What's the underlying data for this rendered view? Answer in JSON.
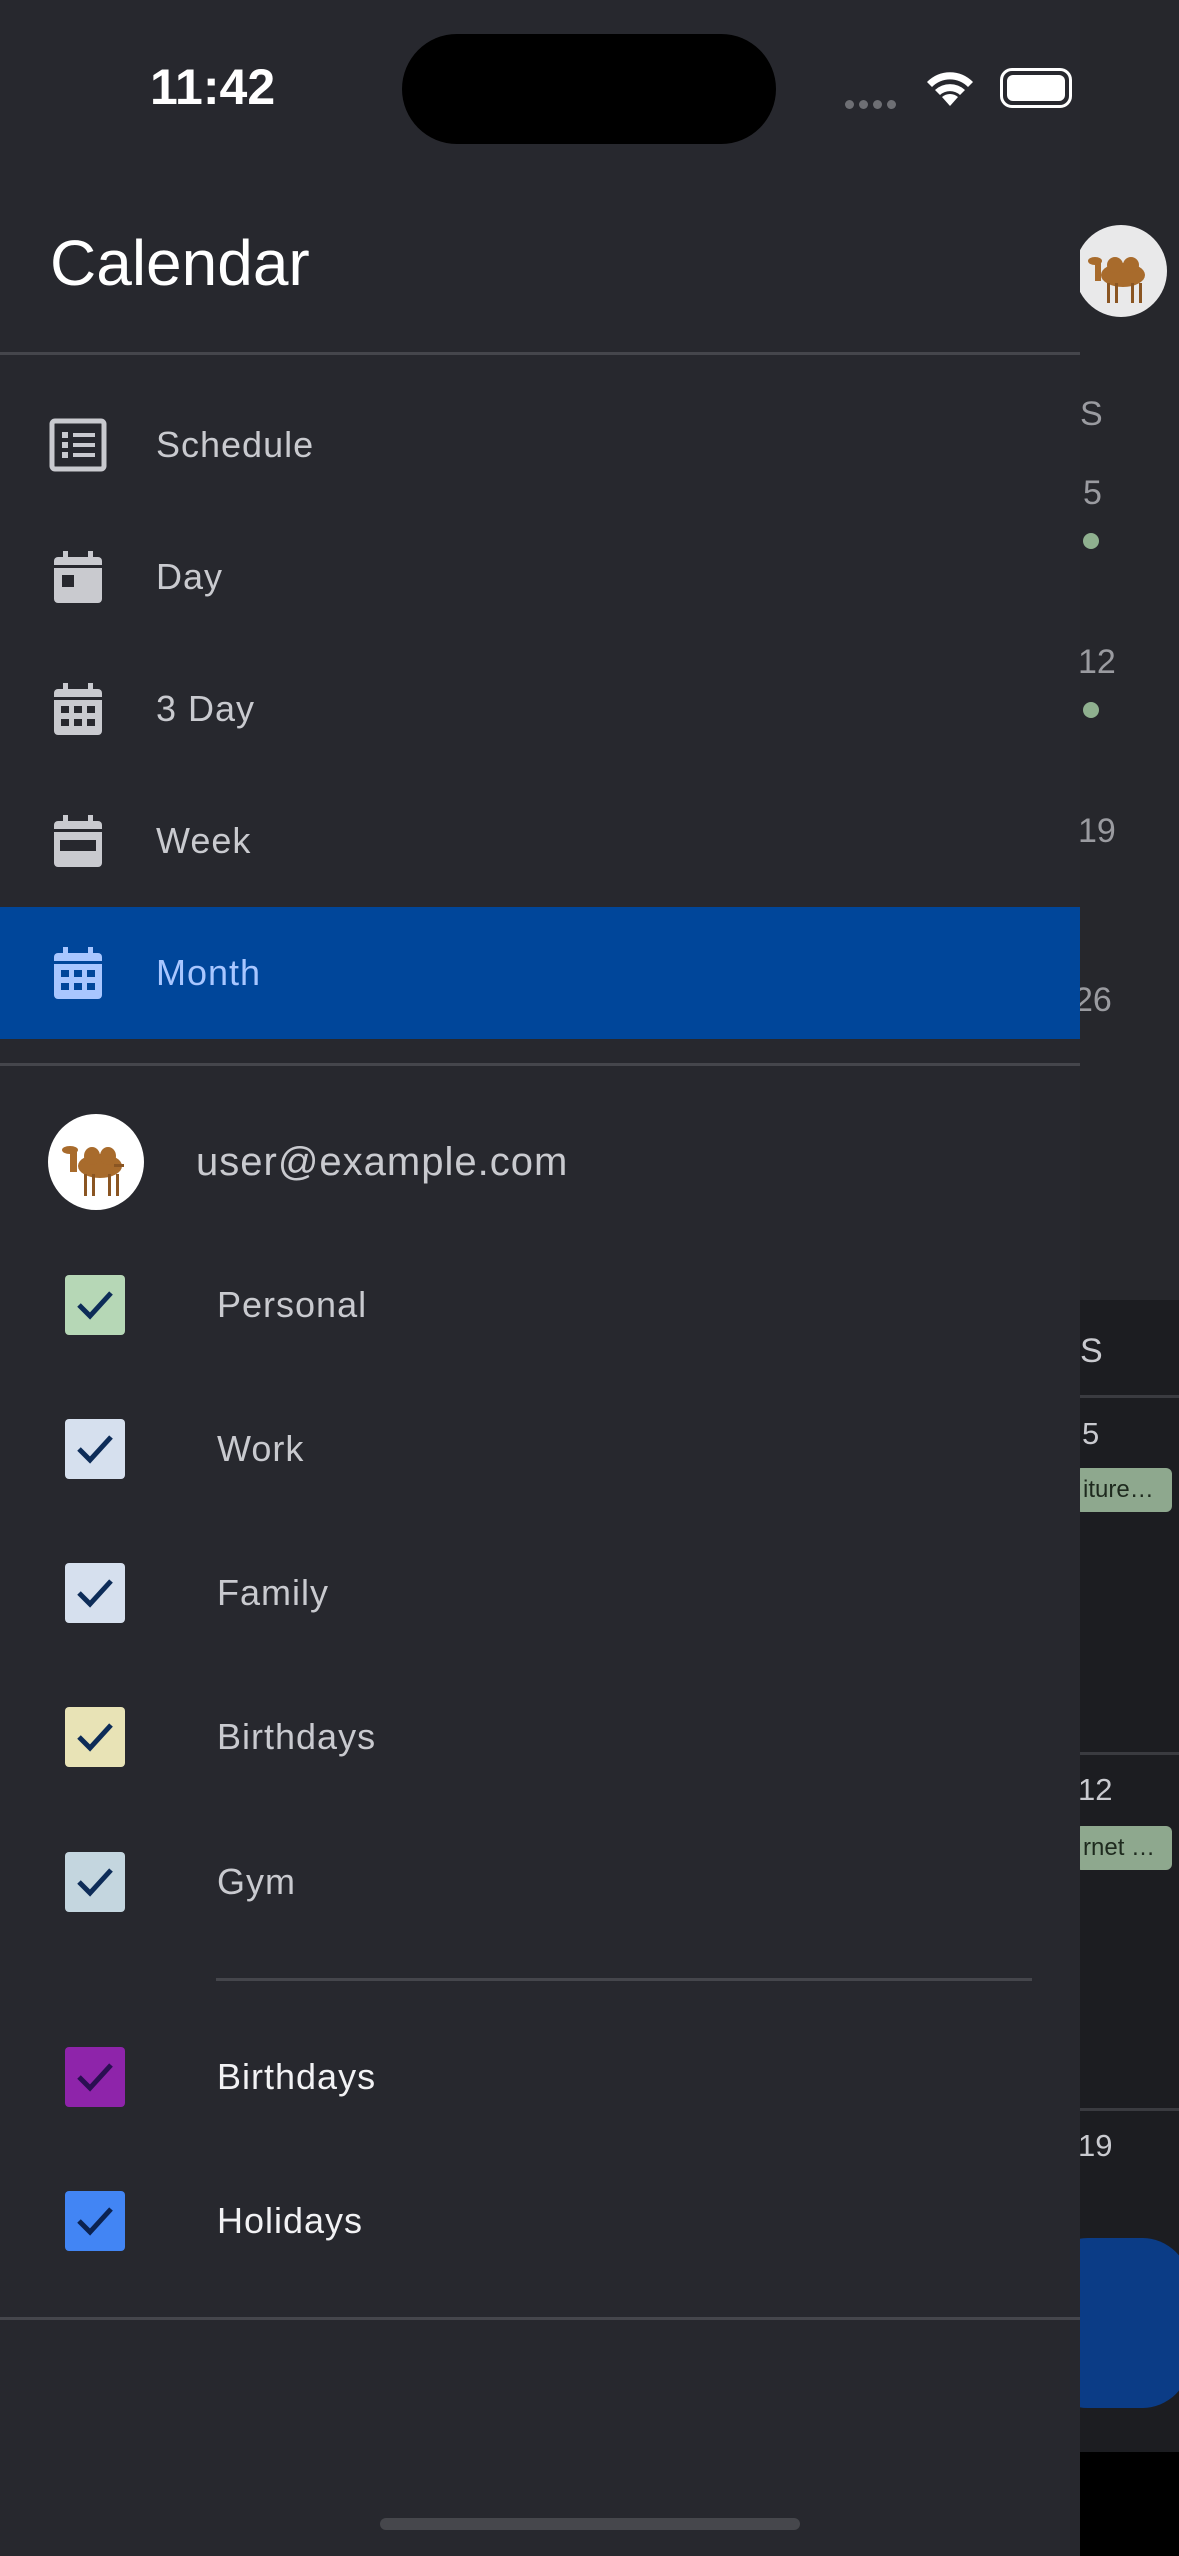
{
  "status_bar": {
    "time": "11:42"
  },
  "drawer": {
    "title": "Calendar",
    "nav_items": [
      {
        "label": "Schedule",
        "icon": "schedule-list-icon",
        "selected": false
      },
      {
        "label": "Day",
        "icon": "calendar-day-icon",
        "selected": false
      },
      {
        "label": "3 Day",
        "icon": "calendar-3day-icon",
        "selected": false
      },
      {
        "label": "Week",
        "icon": "calendar-week-icon",
        "selected": false
      },
      {
        "label": "Month",
        "icon": "calendar-month-icon",
        "selected": true
      }
    ],
    "account": {
      "email": "user@example.com",
      "avatar": "camel-avatar"
    },
    "calendars": [
      {
        "label": "Personal",
        "checked": true,
        "color": "#b6d7b6"
      },
      {
        "label": "Work",
        "checked": true,
        "color": "#d6e0ee"
      },
      {
        "label": "Family",
        "checked": true,
        "color": "#d6e0ee"
      },
      {
        "label": "Birthdays",
        "checked": true,
        "color": "#e8e3b6"
      },
      {
        "label": "Gym",
        "checked": true,
        "color": "#c4d6df"
      }
    ],
    "other_calendars": [
      {
        "label": "Birthdays",
        "checked": true,
        "color": "#8e24aa"
      },
      {
        "label": "Holidays",
        "checked": true,
        "color": "#4285f4"
      }
    ]
  },
  "background": {
    "weekday_header": "S",
    "month_dates": [
      "5",
      "12",
      "19",
      "26"
    ],
    "agenda_header": "S",
    "agenda_dates": [
      "5",
      "12",
      "19"
    ],
    "chips": [
      "iture…",
      "rnet …"
    ]
  },
  "colors": {
    "drawer_bg": "#27282e",
    "selected_bg": "#00469a",
    "selected_text": "#a8c6ff"
  }
}
